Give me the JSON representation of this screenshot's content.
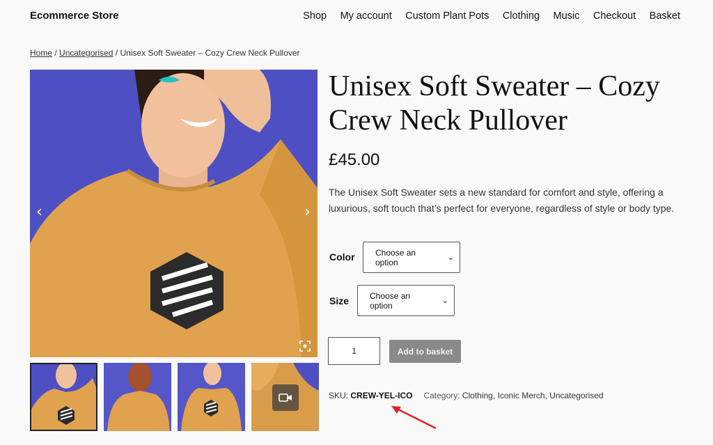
{
  "header": {
    "site_title": "Ecommerce Store",
    "nav": [
      "Shop",
      "My account",
      "Custom Plant Pots",
      "Clothing",
      "Music",
      "Checkout",
      "Basket"
    ]
  },
  "breadcrumb": {
    "home": "Home",
    "category": "Uncategorised",
    "sep": " / ",
    "current": "Unisex Soft Sweater – Cozy Crew Neck Pullover"
  },
  "product": {
    "title": "Unisex Soft Sweater – Cozy Crew Neck Pullover",
    "price": "£45.00",
    "description": "The Unisex Soft Sweater sets a new standard for comfort and style, offering a luxurious, soft touch that’s perfect for everyone, regardless of style or body type.",
    "options": [
      {
        "label": "Color",
        "placeholder": "Choose an option"
      },
      {
        "label": "Size",
        "placeholder": "Choose an option"
      }
    ],
    "quantity": "1",
    "add_to_basket": "Add to basket",
    "sku_label": "SKU:",
    "sku": "CREW-YEL-ICO",
    "category_label": "Category:",
    "categories": "Clothing, Iconic Merch, Uncategorised"
  },
  "gallery": {
    "prev_icon": "chevron-left-icon",
    "next_icon": "chevron-right-icon",
    "zoom_icon": "fullscreen-icon",
    "video_icon": "video-camera-icon"
  },
  "colors": {
    "background": "#4e4fc3",
    "sweater": "#e0a24f",
    "button": "#8a8a8a",
    "annotation_arrow": "#e02424"
  }
}
